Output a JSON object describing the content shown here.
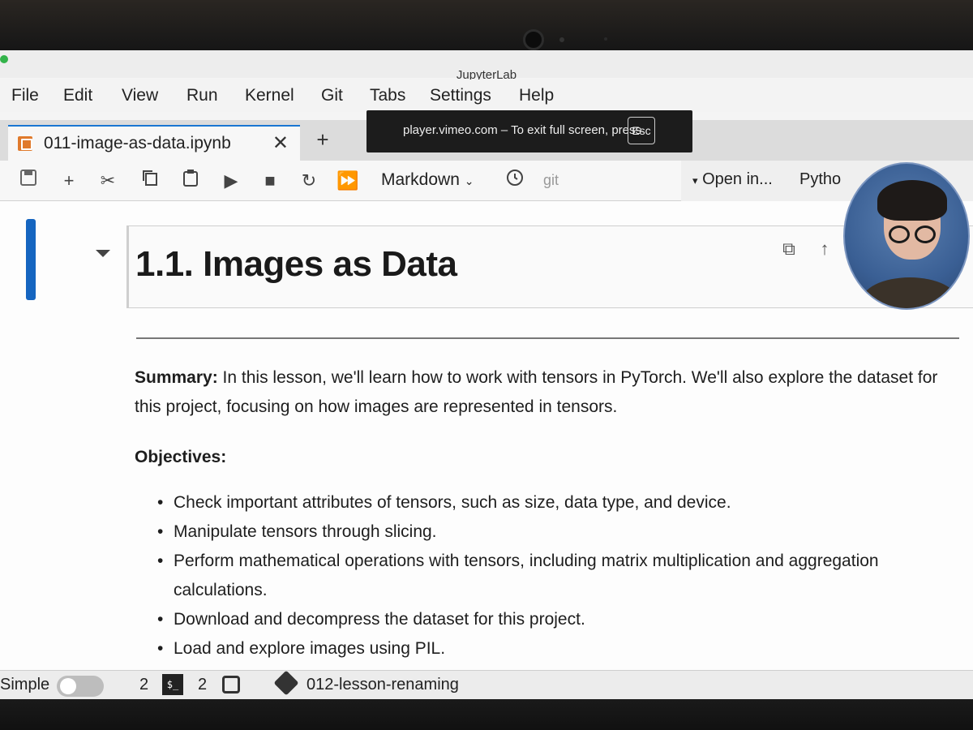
{
  "app": {
    "title": "JupyterLab"
  },
  "menu": [
    "File",
    "Edit",
    "View",
    "Run",
    "Kernel",
    "Git",
    "Tabs",
    "Settings",
    "Help"
  ],
  "tab": {
    "label": "011-image-as-data.ipynb",
    "close": "✕",
    "add": "+"
  },
  "toolbar": {
    "cell_type": "Markdown",
    "git": "git",
    "open_in": "Open in...",
    "kernel": "Pytho"
  },
  "notice": {
    "text": "player.vimeo.com – To exit full screen, press",
    "key": "Esc"
  },
  "notebook": {
    "heading": "1.1. Images as Data",
    "summary_label": "Summary:",
    "summary_text": " In this lesson, we'll learn how to work with tensors in PyTorch. We'll also explore the dataset for this project, focusing on how images are represented in tensors.",
    "objectives_label": "Objectives:",
    "objectives": [
      "Check important attributes of tensors, such as size, data type, and device.",
      "Manipulate tensors through slicing.",
      "Perform mathematical operations with tensors, including matrix multiplication and aggregation calculations.",
      "Download and decompress the dataset for this project.",
      "Load and explore images using PIL."
    ]
  },
  "statusbar": {
    "mode_label": "Simple",
    "kernels_count": "2",
    "terminals_count": "2",
    "terminal_icon_glyph": "$_",
    "branch": "012-lesson-renaming"
  },
  "colors": {
    "accent": "#1565c0",
    "notice_bg": "#1c1c1c"
  }
}
